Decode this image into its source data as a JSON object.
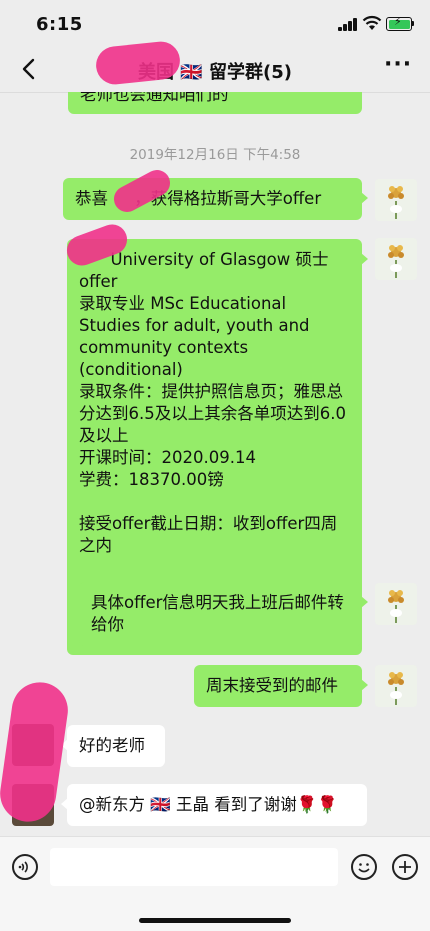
{
  "status_bar": {
    "time": "6:15"
  },
  "header": {
    "title": "美国 🇬🇧 留学群(5)",
    "more_label": "···"
  },
  "messages": {
    "partial_top": "老师也会通知咱们的",
    "timestamp": "2019年12月16日 下午4:58",
    "m1": "恭喜     ，获得格拉斯哥大学offer",
    "m2": "      University of Glasgow 硕士offer\n录取专业 MSc Educational Studies for adult, youth and community contexts (conditional)\n录取条件：提供护照信息页；雅思总分达到6.5及以上其余各单项达到6.0及以上\n开课时间：2020.09.14\n学费：18370.00镑\n\n接受offer截止日期：收到offer四周之内",
    "m3": "具体offer信息明天我上班后邮件转给你",
    "m4": "周末接受到的邮件",
    "m5": "好的老师",
    "m6": "@新东方 🇬🇧 王晶 看到了谢谢🌹🌹"
  },
  "input": {
    "placeholder": ""
  }
}
